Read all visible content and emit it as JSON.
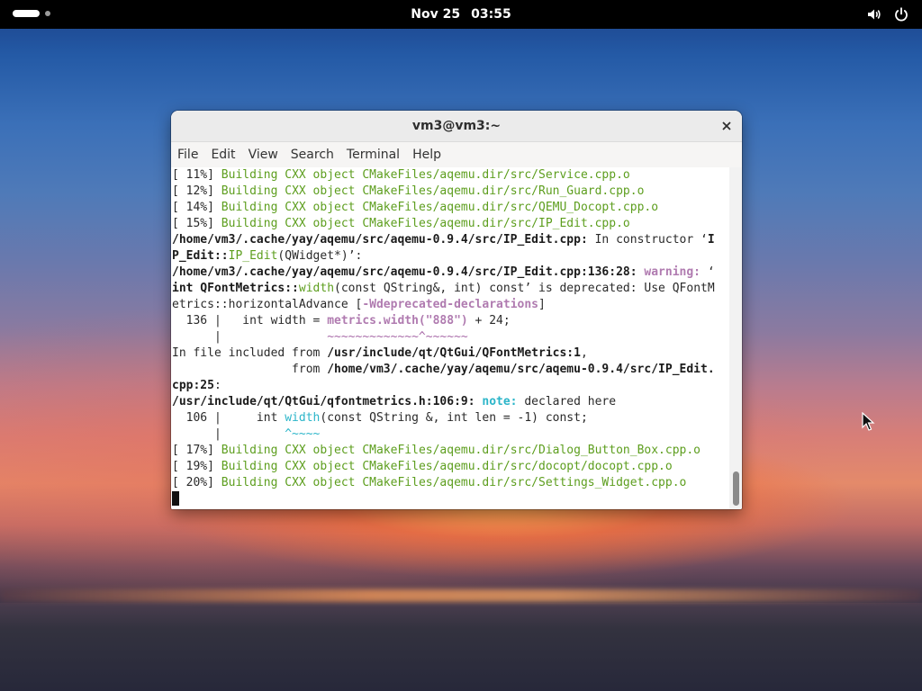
{
  "topbar": {
    "date": "Nov 25",
    "time": "03:55",
    "icons": [
      "activities-icon",
      "volume-icon",
      "power-icon"
    ]
  },
  "window": {
    "title": "vm3@vm3:~",
    "close_icon": "close-icon",
    "menu": [
      "File",
      "Edit",
      "View",
      "Search",
      "Terminal",
      "Help"
    ]
  },
  "terminal": {
    "lines": [
      [
        {
          "t": "[ 11%] "
        },
        {
          "t": "Building CXX object CMakeFiles/aqemu.dir/src/Service.cpp.o",
          "c": "g"
        }
      ],
      [
        {
          "t": "[ 12%] "
        },
        {
          "t": "Building CXX object CMakeFiles/aqemu.dir/src/Run_Guard.cpp.o",
          "c": "g"
        }
      ],
      [
        {
          "t": "[ 14%] "
        },
        {
          "t": "Building CXX object CMakeFiles/aqemu.dir/src/QEMU_Docopt.cpp.o",
          "c": "g"
        }
      ],
      [
        {
          "t": "[ 15%] "
        },
        {
          "t": "Building CXX object CMakeFiles/aqemu.dir/src/IP_Edit.cpp.o",
          "c": "g"
        }
      ],
      [
        {
          "t": "/home/vm3/.cache/yay/aqemu/src/aqemu-0.9.4/src/IP_Edit.cpp:",
          "c": "b"
        },
        {
          "t": " In constructor ‘"
        },
        {
          "t": "I",
          "c": "b"
        }
      ],
      [
        {
          "t": "P_Edit::",
          "c": "b"
        },
        {
          "t": "IP_Edit",
          "c": "g"
        },
        {
          "t": "(QWidget*)’:"
        }
      ],
      [
        {
          "t": "/home/vm3/.cache/yay/aqemu/src/aqemu-0.9.4/src/IP_Edit.cpp:136:28:",
          "c": "b"
        },
        {
          "t": " "
        },
        {
          "t": "warning:",
          "c": "mb"
        },
        {
          "t": " ‘"
        }
      ],
      [
        {
          "t": "int QFontMetrics::",
          "c": "b"
        },
        {
          "t": "width",
          "c": "g"
        },
        {
          "t": "(const QString&, int) const’ is deprecated: Use QFontM"
        }
      ],
      [
        {
          "t": "etrics::horizontalAdvance ["
        },
        {
          "t": "-Wdeprecated-declarations",
          "c": "mb"
        },
        {
          "t": "]"
        }
      ],
      [
        {
          "t": "  136 |   int width = "
        },
        {
          "t": "metrics.width(\"888\")",
          "c": "mb"
        },
        {
          "t": " + 24;"
        }
      ],
      [
        {
          "t": "      |               "
        },
        {
          "t": "~~~~~~~~~~~~~^~~~~~~",
          "c": "m"
        }
      ],
      [
        {
          "t": "In file included from "
        },
        {
          "t": "/usr/include/qt/QtGui/QFontMetrics:1",
          "c": "b"
        },
        {
          "t": ","
        }
      ],
      [
        {
          "t": "                 from "
        },
        {
          "t": "/home/vm3/.cache/yay/aqemu/src/aqemu-0.9.4/src/IP_Edit.",
          "c": "b"
        }
      ],
      [
        {
          "t": "cpp:25",
          "c": "b"
        },
        {
          "t": ":"
        }
      ],
      [
        {
          "t": "/usr/include/qt/QtGui/qfontmetrics.h:106:9:",
          "c": "b"
        },
        {
          "t": " "
        },
        {
          "t": "note:",
          "c": "c"
        },
        {
          "t": " declared here"
        }
      ],
      [
        {
          "t": "  106 |     int "
        },
        {
          "t": "width",
          "c": "cw"
        },
        {
          "t": "(const QString &, int len = -1) const;"
        }
      ],
      [
        {
          "t": "      |         "
        },
        {
          "t": "^~~~~",
          "c": "cw"
        }
      ],
      [
        {
          "t": "[ 17%] "
        },
        {
          "t": "Building CXX object CMakeFiles/aqemu.dir/src/Dialog_Button_Box.cpp.o",
          "c": "g"
        }
      ],
      [
        {
          "t": "[ 19%] "
        },
        {
          "t": "Building CXX object CMakeFiles/aqemu.dir/src/docopt/docopt.cpp.o",
          "c": "g"
        }
      ],
      [
        {
          "t": "[ 20%] "
        },
        {
          "t": "Building CXX object CMakeFiles/aqemu.dir/src/Settings_Widget.cpp.o",
          "c": "g"
        }
      ]
    ]
  }
}
